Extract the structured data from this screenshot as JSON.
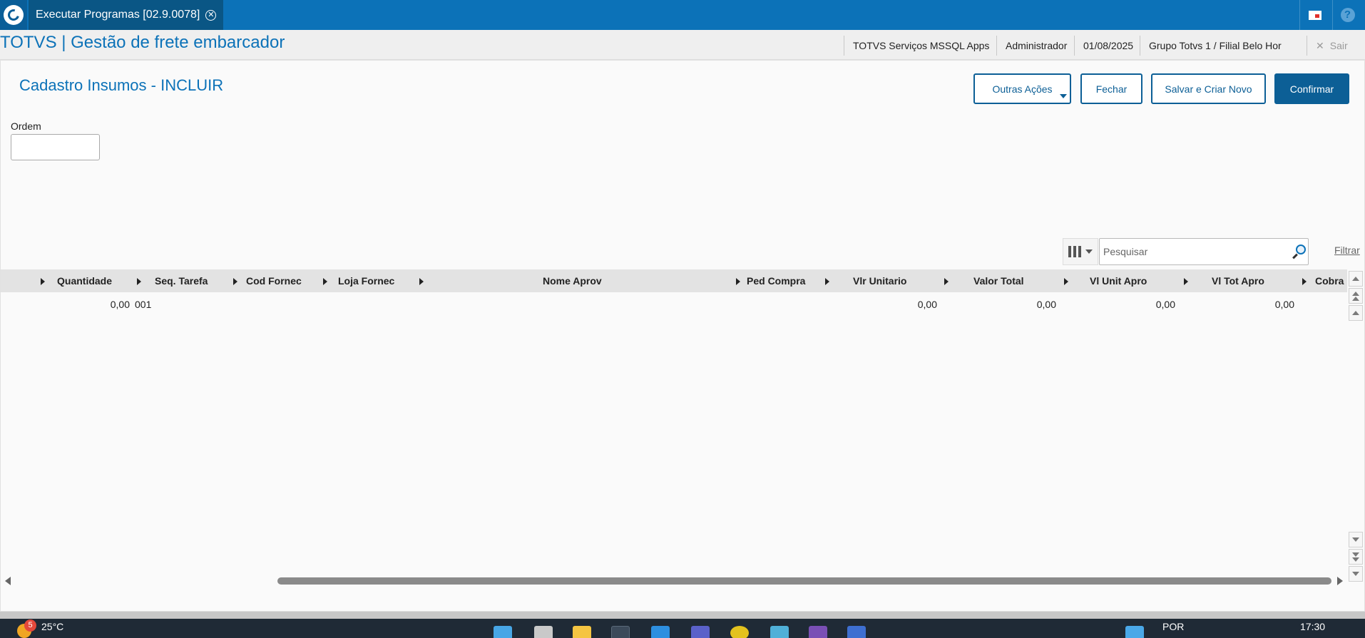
{
  "topbar": {
    "tab_title": "Executar Programas [02.9.0078]",
    "tab_close": "✕"
  },
  "header": {
    "app_title": "TOTVS | Gestão de frete embarcador",
    "server": "TOTVS Serviços MSSQL Apps",
    "user": "Administrador",
    "date": "01/08/2025",
    "company": "Grupo Totvs 1 / Filial Belo Hor",
    "logout": "Sair",
    "logout_icon": "✕"
  },
  "page": {
    "title": "Cadastro Insumos - INCLUIR",
    "buttons": {
      "other_actions": "Outras Ações",
      "close": "Fechar",
      "save_new": "Salvar e Criar Novo",
      "confirm": "Confirmar"
    },
    "ordem_label": "Ordem",
    "ordem_value": ""
  },
  "grid": {
    "search_placeholder": "Pesquisar",
    "filter_label": "Filtrar",
    "columns": [
      "Quantidade",
      "Seq. Tarefa",
      "Cod Fornec",
      "Loja Fornec",
      "Nome Aprov",
      "Ped Compra",
      "Vlr Unitario",
      "Valor Total",
      "Vl Unit Apro",
      "Vl Tot Apro",
      "Cobra"
    ],
    "rows": [
      {
        "quantidade": "0,00",
        "seq_tarefa": "001",
        "vlr_unitario": "0,00",
        "valor_total": "0,00",
        "vl_unit_apro": "0,00",
        "vl_tot_apro": "0,00"
      }
    ]
  },
  "taskbar": {
    "weather_badge": "5",
    "temperature": "25°C",
    "language": "POR",
    "time": "17:30"
  }
}
